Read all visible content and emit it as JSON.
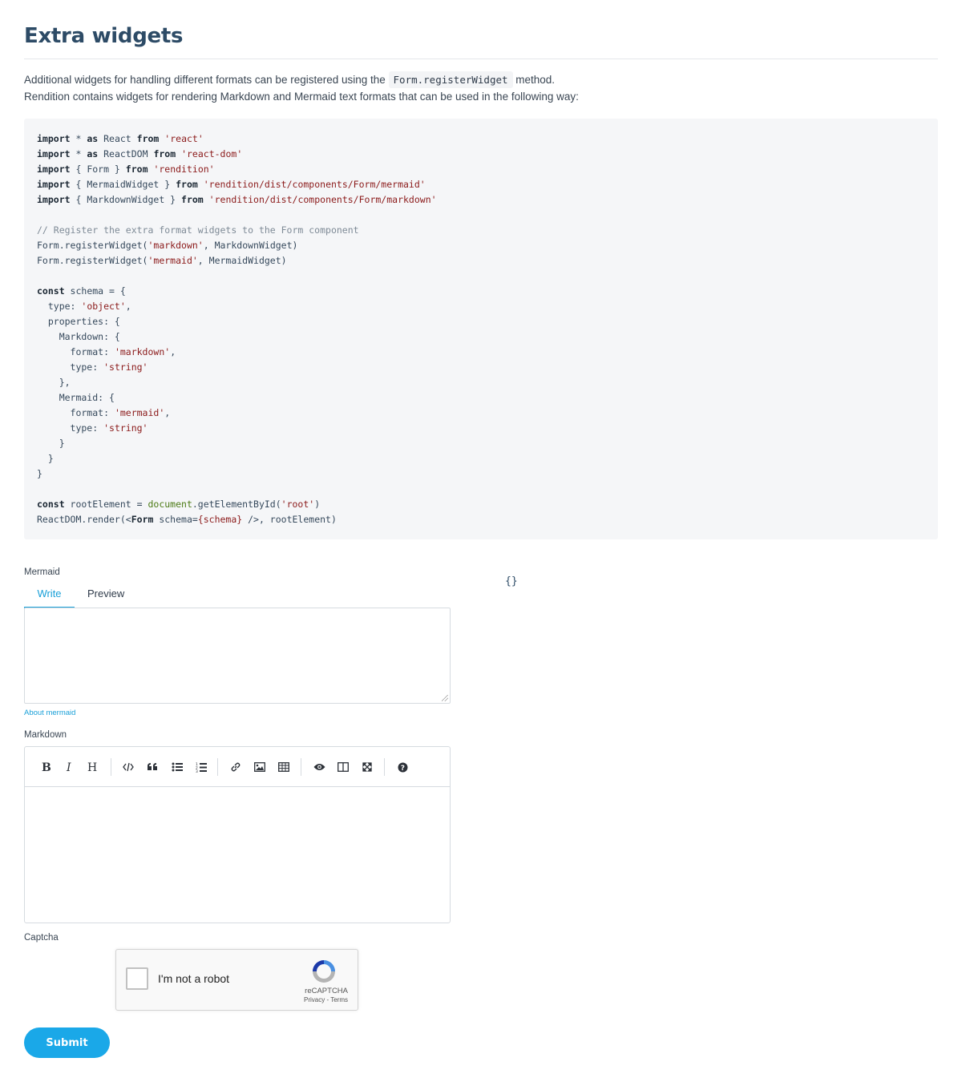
{
  "page_title": "Extra widgets",
  "intro": {
    "line1_before": "Additional widgets for handling different formats can be registered using the ",
    "line1_code": "Form.registerWidget",
    "line1_after": " method.",
    "line2": "Rendition contains widgets for rendering Markdown and Mermaid text formats that can be used in the following way:"
  },
  "code_lines": [
    [
      {
        "t": "import",
        "c": "kw"
      },
      {
        "t": " * "
      },
      {
        "t": "as",
        "c": "kw"
      },
      {
        "t": " React "
      },
      {
        "t": "from",
        "c": "kw"
      },
      {
        "t": " "
      },
      {
        "t": "'react'",
        "c": "str"
      }
    ],
    [
      {
        "t": "import",
        "c": "kw"
      },
      {
        "t": " * "
      },
      {
        "t": "as",
        "c": "kw"
      },
      {
        "t": " ReactDOM "
      },
      {
        "t": "from",
        "c": "kw"
      },
      {
        "t": " "
      },
      {
        "t": "'react-dom'",
        "c": "str"
      }
    ],
    [
      {
        "t": "import",
        "c": "kw"
      },
      {
        "t": " { Form } "
      },
      {
        "t": "from",
        "c": "kw"
      },
      {
        "t": " "
      },
      {
        "t": "'rendition'",
        "c": "str"
      }
    ],
    [
      {
        "t": "import",
        "c": "kw"
      },
      {
        "t": " { MermaidWidget } "
      },
      {
        "t": "from",
        "c": "kw"
      },
      {
        "t": " "
      },
      {
        "t": "'rendition/dist/components/Form/mermaid'",
        "c": "str"
      }
    ],
    [
      {
        "t": "import",
        "c": "kw"
      },
      {
        "t": " { MarkdownWidget } "
      },
      {
        "t": "from",
        "c": "kw"
      },
      {
        "t": " "
      },
      {
        "t": "'rendition/dist/components/Form/markdown'",
        "c": "str"
      }
    ],
    [],
    [
      {
        "t": "// Register the extra format widgets to the Form component",
        "c": "com"
      }
    ],
    [
      {
        "t": "Form.registerWidget("
      },
      {
        "t": "'markdown'",
        "c": "str"
      },
      {
        "t": ", MarkdownWidget)"
      }
    ],
    [
      {
        "t": "Form.registerWidget("
      },
      {
        "t": "'mermaid'",
        "c": "str"
      },
      {
        "t": ", MermaidWidget)"
      }
    ],
    [],
    [
      {
        "t": "const",
        "c": "kw"
      },
      {
        "t": " schema = {"
      }
    ],
    [
      {
        "t": "  type: "
      },
      {
        "t": "'object'",
        "c": "str"
      },
      {
        "t": ","
      }
    ],
    [
      {
        "t": "  properties: {"
      }
    ],
    [
      {
        "t": "    Markdown: {"
      }
    ],
    [
      {
        "t": "      format: "
      },
      {
        "t": "'markdown'",
        "c": "str"
      },
      {
        "t": ","
      }
    ],
    [
      {
        "t": "      type: "
      },
      {
        "t": "'string'",
        "c": "str"
      }
    ],
    [
      {
        "t": "    },"
      }
    ],
    [
      {
        "t": "    Mermaid: {"
      }
    ],
    [
      {
        "t": "      format: "
      },
      {
        "t": "'mermaid'",
        "c": "str"
      },
      {
        "t": ","
      }
    ],
    [
      {
        "t": "      type: "
      },
      {
        "t": "'string'",
        "c": "str"
      }
    ],
    [
      {
        "t": "    }"
      }
    ],
    [
      {
        "t": "  }"
      }
    ],
    [
      {
        "t": "}"
      }
    ],
    [],
    [
      {
        "t": "const",
        "c": "kw"
      },
      {
        "t": " rootElement = "
      },
      {
        "t": "document",
        "c": "glob"
      },
      {
        "t": ".getElementById("
      },
      {
        "t": "'root'",
        "c": "str"
      },
      {
        "t": ")"
      }
    ],
    [
      {
        "t": "ReactDOM.render(<"
      },
      {
        "t": "Form",
        "c": "tag"
      },
      {
        "t": " schema="
      },
      {
        "t": "{schema}",
        "c": "str"
      },
      {
        "t": " />, rootElement)"
      }
    ]
  ],
  "form": {
    "mermaid_label": "Mermaid",
    "tab_write": "Write",
    "tab_preview": "Preview",
    "mermaid_value": "",
    "help_link": "About mermaid",
    "markdown_label": "Markdown",
    "toolbar_icons": [
      "bold-icon",
      "italic-icon",
      "heading-icon",
      "code-icon",
      "quote-icon",
      "unordered-list-icon",
      "ordered-list-icon",
      "link-icon",
      "image-icon",
      "table-icon",
      "preview-icon",
      "side-by-side-icon",
      "fullscreen-icon",
      "help-icon"
    ],
    "captcha_label": "Captcha",
    "captcha_text": "I'm not a robot",
    "captcha_brand": "reCAPTCHA",
    "captcha_links": "Privacy - Terms",
    "submit_label": "Submit"
  },
  "output_json": "{}",
  "colors": {
    "accent": "#1aa8e8",
    "heading": "#2d4b66",
    "code_string": "#8b1a1a",
    "code_comment": "#7e8a96"
  }
}
